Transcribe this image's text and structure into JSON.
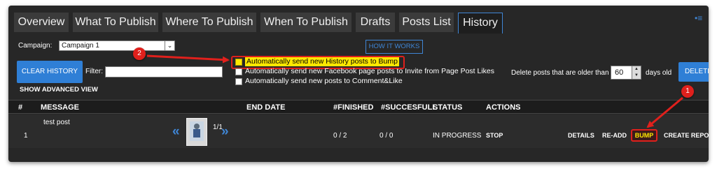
{
  "tabs": [
    {
      "label": "Overview",
      "active": false
    },
    {
      "label": "What To Publish",
      "active": false
    },
    {
      "label": "Where To Publish",
      "active": false
    },
    {
      "label": "When To Publish",
      "active": false
    },
    {
      "label": "Drafts",
      "active": false
    },
    {
      "label": "Posts List",
      "active": false
    },
    {
      "label": "History",
      "active": true
    }
  ],
  "campaign": {
    "label": "Campaign:",
    "value": "Campaign 1"
  },
  "how_it_works": "HOW IT WORKS",
  "clear_history": "CLEAR HISTORY",
  "filter": {
    "label": "Filter:",
    "value": ""
  },
  "show_advanced": "SHOW ADVANCED VIEW",
  "options": [
    {
      "label": "Automatically send new History posts to Bump",
      "checked": false,
      "highlighted": true
    },
    {
      "label": "Automatically send new Facebook page posts to Invite from Page Post Likes",
      "checked": false,
      "highlighted": false
    },
    {
      "label": "Automatically send new posts to Comment&Like",
      "checked": false,
      "highlighted": false
    }
  ],
  "delete_posts": {
    "label_before": "Delete posts that are older than",
    "value": "60",
    "label_after": "days old",
    "button": "DELETE"
  },
  "table": {
    "headers": [
      "#",
      "MESSAGE",
      "END DATE",
      "#FINISHED",
      "#SUCCESFULL",
      "STATUS",
      "ACTIONS"
    ],
    "rows": [
      {
        "index": "1",
        "message": "test post",
        "media_pager": "1/1",
        "end_date": "",
        "finished": "0 / 2",
        "successful": "0 / 0",
        "status": "IN PROGRESS",
        "stop": "STOP",
        "actions": [
          "DETAILS",
          "RE-ADD",
          "BUMP",
          "CREATE REPORT"
        ]
      }
    ]
  },
  "annotations": {
    "badge_1": "1",
    "badge_2": "2"
  },
  "colors": {
    "accent": "#3f86d6",
    "highlight": "#ffe800",
    "annotation": "#e0201c",
    "panel": "#272727"
  },
  "icons": {
    "prev": "double-chevron-left-icon",
    "next": "double-chevron-right-icon",
    "menu": "menu-icon"
  }
}
